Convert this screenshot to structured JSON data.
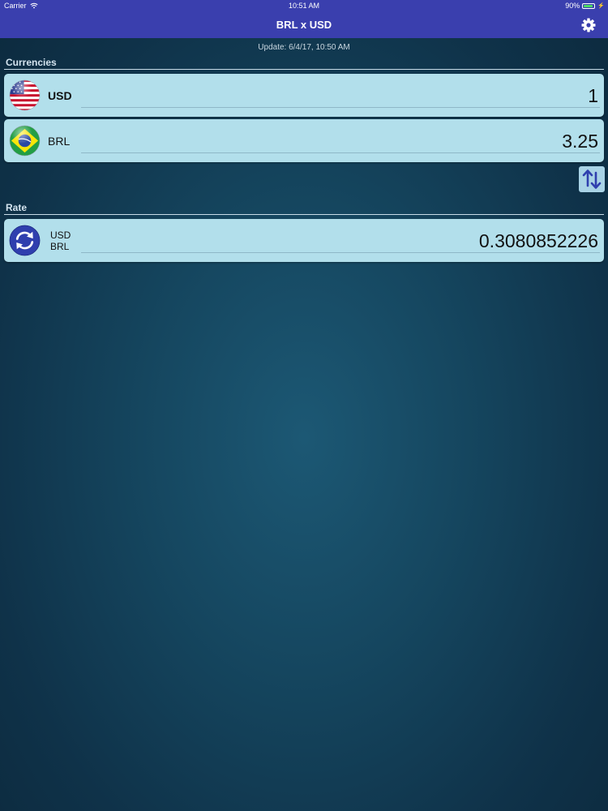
{
  "status_bar": {
    "carrier": "Carrier",
    "time": "10:51 AM",
    "battery": "90%",
    "battery_level": 0.9
  },
  "nav": {
    "title": "BRL x USD"
  },
  "update_text": "Update: 6/4/17, 10:50 AM",
  "sections": {
    "currencies_label": "Currencies",
    "rate_label": "Rate"
  },
  "currencies": [
    {
      "code": "USD",
      "value": "1"
    },
    {
      "code": "BRL",
      "value": "3.25"
    }
  ],
  "rate": {
    "from": "USD",
    "to": "BRL",
    "value": "0.3080852226"
  },
  "colors": {
    "nav": "#3a3fae",
    "card": "#b2dfeb",
    "icon_blue": "#2f3fae"
  },
  "icons": {
    "settings": "gear-icon",
    "swap": "swap-arrows-icon",
    "rate": "refresh-icon",
    "usd_flag": "us-flag-icon",
    "brl_flag": "brazil-flag-icon"
  }
}
